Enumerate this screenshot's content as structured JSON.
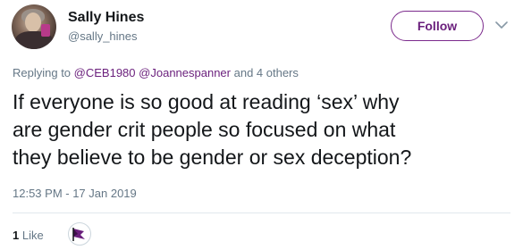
{
  "author": {
    "name": "Sally Hines",
    "handle": "@sally_hines",
    "avatar_icon": "profile-photo"
  },
  "follow_button": {
    "label": "Follow"
  },
  "menu": {
    "icon": "chevron-down-icon"
  },
  "replying": {
    "prefix": "Replying to",
    "mentions": [
      "@CEB1980",
      "@Joannespanner"
    ],
    "suffix": "and 4 others"
  },
  "tweet": {
    "lines": [
      "If everyone is so good at reading ‘sex’ why",
      "are gender crit people so focused on what",
      "they believe to be gender or sex deception?"
    ],
    "timestamp": "12:53 PM - 17 Jan 2019"
  },
  "engagement": {
    "like_count": "1",
    "like_label": "Like",
    "liker_icon": "purple-flag-icon"
  },
  "colors": {
    "accent": "#6a1f7c",
    "text": "#14171a",
    "muted": "#657786",
    "divider": "#e1e8ed"
  }
}
